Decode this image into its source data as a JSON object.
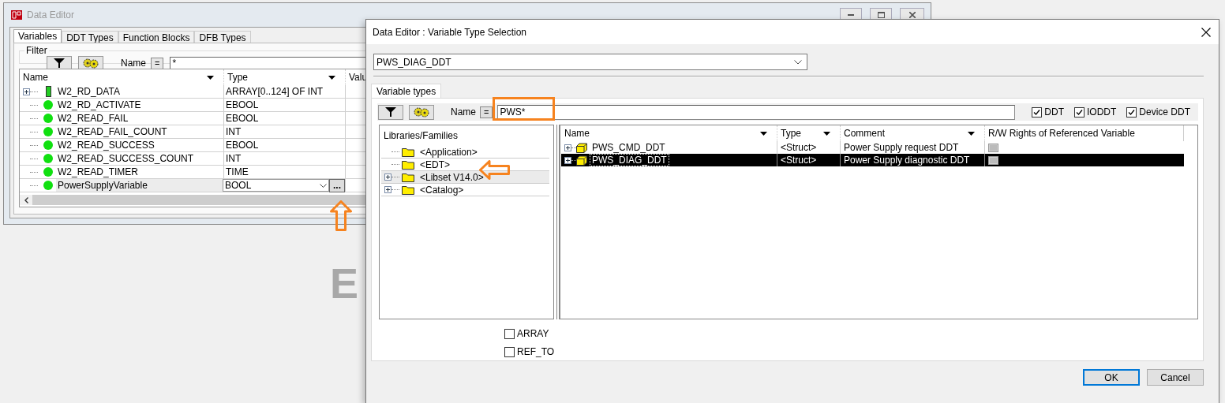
{
  "background_text": "E",
  "data_editor": {
    "title": "Data Editor",
    "tabs": [
      {
        "label": "Variables",
        "selected": true
      },
      {
        "label": "DDT Types",
        "selected": false
      },
      {
        "label": "Function Blocks",
        "selected": false
      },
      {
        "label": "DFB Types",
        "selected": false
      }
    ],
    "filter": {
      "label": "Filter",
      "name_label": "Name",
      "operator": "=",
      "value": "*"
    },
    "table": {
      "columns": [
        "Name",
        "Type",
        "Valu"
      ],
      "browse_label": "...",
      "rows": [
        {
          "name": "W2_RD_DATA",
          "type": "ARRAY[0..124] OF INT",
          "kind": "array",
          "expandable": true,
          "selected": false
        },
        {
          "name": "W2_RD_ACTIVATE",
          "type": "EBOOL",
          "kind": "elementary",
          "expandable": false,
          "selected": false
        },
        {
          "name": "W2_READ_FAIL",
          "type": "EBOOL",
          "kind": "elementary",
          "expandable": false,
          "selected": false
        },
        {
          "name": "W2_READ_FAIL_COUNT",
          "type": "INT",
          "kind": "elementary",
          "expandable": false,
          "selected": false
        },
        {
          "name": "W2_READ_SUCCESS",
          "type": "EBOOL",
          "kind": "elementary",
          "expandable": false,
          "selected": false
        },
        {
          "name": "W2_READ_SUCCESS_COUNT",
          "type": "INT",
          "kind": "elementary",
          "expandable": false,
          "selected": false
        },
        {
          "name": "W2_READ_TIMER",
          "type": "TIME",
          "kind": "elementary",
          "expandable": false,
          "selected": false
        },
        {
          "name": "PowerSupplyVariable",
          "type": "BOOL",
          "kind": "elementary",
          "expandable": false,
          "selected": true
        }
      ]
    }
  },
  "dialog": {
    "title": "Data Editor : Variable Type Selection",
    "type_value": "PWS_DIAG_DDT",
    "tabs": [
      {
        "label": "Variable types",
        "selected": true
      }
    ],
    "filter": {
      "name_label": "Name",
      "operator": "=",
      "value": "PWS*"
    },
    "type_filters": [
      {
        "label": "DDT",
        "checked": true
      },
      {
        "label": "IODDT",
        "checked": true
      },
      {
        "label": "Device DDT",
        "checked": true
      }
    ],
    "tree": {
      "header": "Libraries/Families",
      "items": [
        {
          "label": "<Application>",
          "expandable": false,
          "selected": false
        },
        {
          "label": "<EDT>",
          "expandable": false,
          "selected": false
        },
        {
          "label": "<Libset V14.0>",
          "expandable": true,
          "selected": true
        },
        {
          "label": "<Catalog>",
          "expandable": true,
          "selected": false
        }
      ]
    },
    "list": {
      "columns": [
        "Name",
        "Type",
        "Comment",
        "R/W Rights of Referenced Variable"
      ],
      "rows": [
        {
          "name": "PWS_CMD_DDT",
          "type": "<Struct>",
          "comment": "Power Supply request DDT",
          "selected": false
        },
        {
          "name": "PWS_DIAG_DDT",
          "type": "<Struct>",
          "comment": "Power Supply diagnostic DDT",
          "selected": true
        }
      ]
    },
    "options": [
      {
        "label": "ARRAY",
        "checked": false
      },
      {
        "label": "REF_TO",
        "checked": false
      }
    ],
    "buttons": [
      {
        "label": "OK",
        "default": true
      },
      {
        "label": "Cancel",
        "default": false
      }
    ]
  },
  "annotations": [
    {
      "kind": "up-arrow"
    },
    {
      "kind": "rectangle"
    },
    {
      "kind": "left-arrow"
    }
  ]
}
